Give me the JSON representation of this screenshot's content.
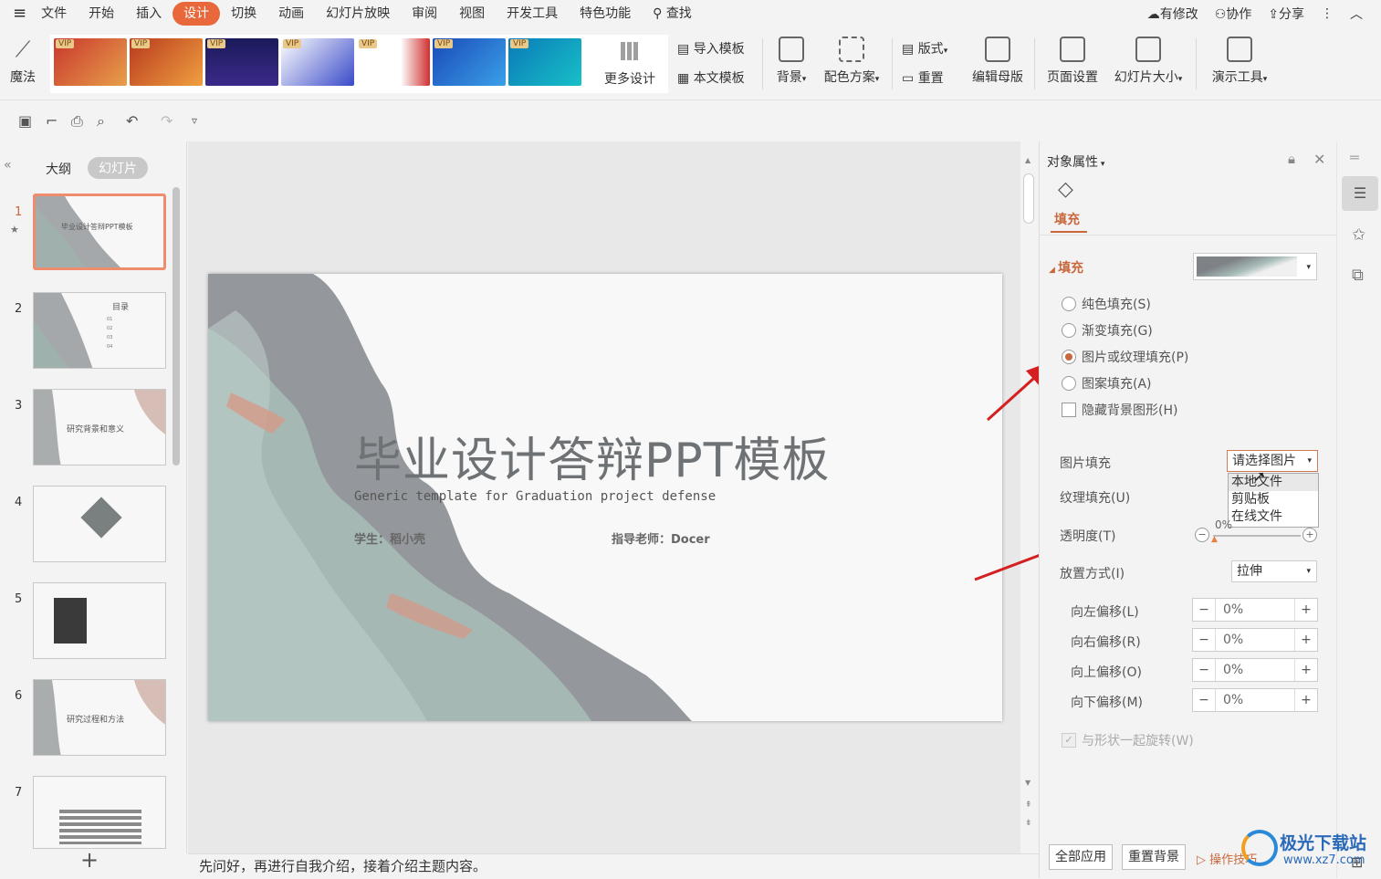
{
  "menubar": {
    "items": [
      "文件",
      "开始",
      "插入",
      "设计",
      "切换",
      "动画",
      "幻灯片放映",
      "审阅",
      "视图",
      "开发工具",
      "特色功能",
      "查找"
    ],
    "active_index": 3,
    "right": {
      "modified": "有修改",
      "collab": "协作",
      "share": "分享"
    }
  },
  "ribbon": {
    "magic": "魔法",
    "vip": "VIP",
    "more_designs": "更多设计",
    "import_template": "导入模板",
    "this_template": "本文模板",
    "background": "背景",
    "color_scheme": "配色方案",
    "layout": "版式",
    "reset": "重置",
    "edit_master": "编辑母版",
    "page_setup": "页面设置",
    "slide_size": "幻灯片大小",
    "present_tools": "演示工具"
  },
  "left_panel": {
    "tab_outline": "大纲",
    "tab_slides": "幻灯片",
    "slides": [
      {
        "num": "1",
        "title": "毕业设计答辩PPT模板"
      },
      {
        "num": "2",
        "title": "目录",
        "items": [
          "01",
          "02",
          "03",
          "04"
        ]
      },
      {
        "num": "3",
        "title": "研究背景和意义"
      },
      {
        "num": "4",
        "title": ""
      },
      {
        "num": "5",
        "title": ""
      },
      {
        "num": "6",
        "title": "研究过程和方法"
      },
      {
        "num": "7",
        "title": ""
      }
    ],
    "add": "+"
  },
  "slide": {
    "title": "毕业设计答辩PPT模板",
    "subtitle": "Generic template for Graduation project defense",
    "student": "学生：稻小壳",
    "teacher": "指导老师：Docer"
  },
  "notes": "先问好，再进行自我介绍，接着介绍主题内容。",
  "props": {
    "header": "对象属性",
    "tab_fill": "填充",
    "section_fill": "填充",
    "options": [
      "纯色填充(S)",
      "渐变填充(G)",
      "图片或纹理填充(P)",
      "图案填充(A)"
    ],
    "selected_option": 2,
    "hide_bg": "隐藏背景图形(H)",
    "picture_fill": "图片填充",
    "choose_picture": "请选择图片",
    "dropdown_items": [
      "本地文件",
      "剪贴板",
      "在线文件"
    ],
    "texture_fill": "纹理填充(U)",
    "transparency": "透明度(T)",
    "transparency_value": "0%",
    "placement": "放置方式(I)",
    "placement_value": "拉伸",
    "offsets": [
      {
        "label": "向左偏移(L)",
        "value": "0%"
      },
      {
        "label": "向右偏移(R)",
        "value": "0%"
      },
      {
        "label": "向上偏移(O)",
        "value": "0%"
      },
      {
        "label": "向下偏移(M)",
        "value": "0%"
      }
    ],
    "rotate_with_shape": "与形状一起旋转(W)",
    "apply_all": "全部应用",
    "reset_bg": "重置背景",
    "tips": "操作技巧"
  },
  "watermark": {
    "name": "极光下载站",
    "url": "www.xz7.com"
  }
}
